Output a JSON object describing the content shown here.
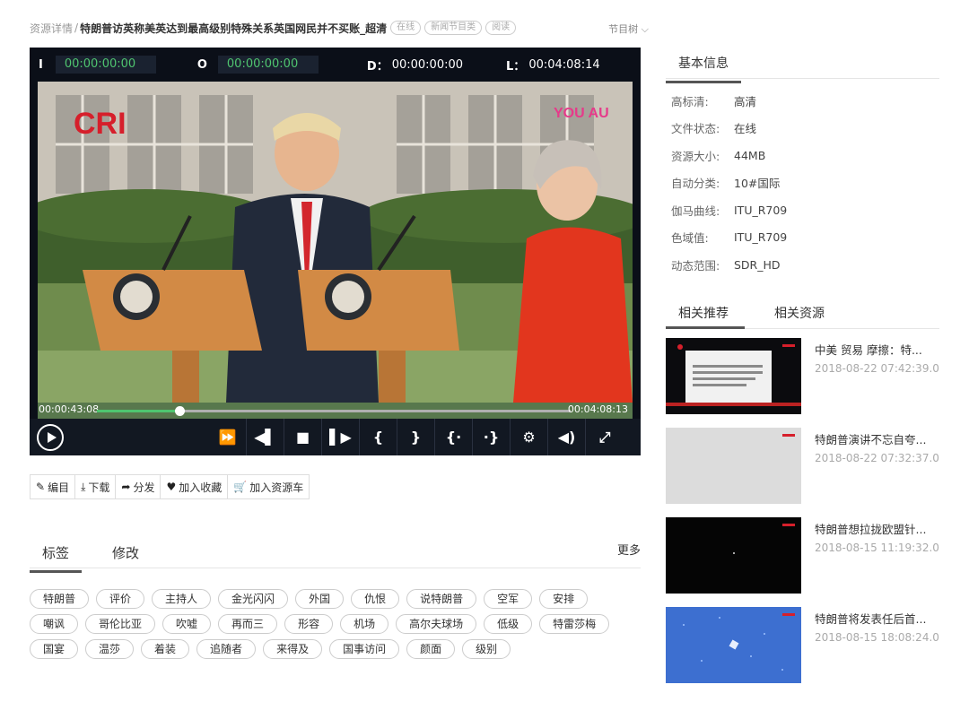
{
  "breadcrumb": {
    "root": "资源详情",
    "sep": "/",
    "title": "特朗普访英称美英达到最高级别特殊关系英国网民并不买账_超清",
    "badges": [
      "在线",
      "新闻节目类",
      "阅读"
    ],
    "tree_label": "节目树"
  },
  "player": {
    "in_label": "I",
    "in_value": "00:00:00:00",
    "out_label": "O",
    "out_value": "00:00:00:00",
    "dur_label": "D：",
    "dur_value": "00:00:00:00",
    "len_label": "L：",
    "len_value": "00:04:08:14",
    "current_time": "00:00:43:08",
    "total_time": "00:04:08:13",
    "progress": 0.174,
    "logo_left": "CRI",
    "logo_right": "YOU AU",
    "controls": [
      "next-frame",
      "prev-frame",
      "stop",
      "play-step",
      "mark-in",
      "mark-out",
      "goto-in",
      "goto-out",
      "settings",
      "volume",
      "fullscreen"
    ],
    "control_glyphs": [
      "⏩",
      "◀▌",
      "■",
      "▌▶",
      "{",
      "}",
      "{·",
      "·}",
      "⚙",
      "◀)",
      "⤢"
    ]
  },
  "actions": [
    {
      "icon": "edit-icon",
      "glyph": "✎",
      "label": "编目"
    },
    {
      "icon": "download-icon",
      "glyph": "⤓",
      "label": "下载"
    },
    {
      "icon": "share-icon",
      "glyph": "➦",
      "label": "分发"
    },
    {
      "icon": "heart-icon",
      "glyph": "♥",
      "label": "加入收藏"
    },
    {
      "icon": "cart-icon",
      "glyph": "🛒",
      "label": "加入资源车"
    }
  ],
  "tag_section": {
    "tabs": [
      "标签",
      "修改"
    ],
    "more": "更多",
    "tags": [
      "特朗普",
      "评价",
      "主持人",
      "金光闪闪",
      "外国",
      "仇恨",
      "说特朗普",
      "空军",
      "安排",
      "嘲讽",
      "哥伦比亚",
      "吹嘘",
      "再而三",
      "形容",
      "机场",
      "高尔夫球场",
      "低级",
      "特雷莎梅",
      "国宴",
      "温莎",
      "着装",
      "追随者",
      "来得及",
      "国事访问",
      "颜面",
      "级别"
    ]
  },
  "basic_info": {
    "tab": "基本信息",
    "rows": [
      {
        "k": "高标清:",
        "v": "高清"
      },
      {
        "k": "文件状态:",
        "v": "在线"
      },
      {
        "k": "资源大小:",
        "v": "44MB"
      },
      {
        "k": "自动分类:",
        "v": "10#国际"
      },
      {
        "k": "伽马曲线:",
        "v": "ITU_R709"
      },
      {
        "k": "色域值:",
        "v": "ITU_R709"
      },
      {
        "k": "动态范围:",
        "v": "SDR_HD"
      }
    ]
  },
  "related": {
    "tabs": [
      "相关推荐",
      "相关资源"
    ],
    "items": [
      {
        "title": "中美 贸易 摩擦：特...",
        "time": "2018-08-22 07:42:39.0"
      },
      {
        "title": "特朗普演讲不忘自夸...",
        "time": "2018-08-22 07:32:37.0"
      },
      {
        "title": "特朗普想拉拢欧盟针...",
        "time": "2018-08-15 11:19:32.0"
      },
      {
        "title": "特朗普将发表任后首...",
        "time": "2018-08-15 18:08:24.0"
      }
    ]
  },
  "colors": {
    "accent_green": "#4fc46f",
    "player_bg": "#0b0f18"
  }
}
